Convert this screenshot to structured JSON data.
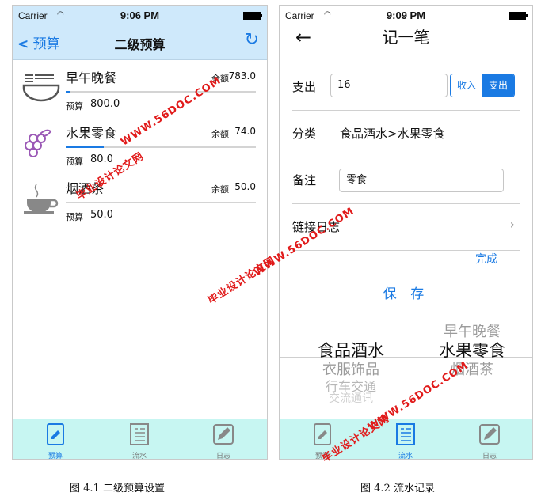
{
  "status": {
    "carrier": "Carrier",
    "time_left": "9:06 PM",
    "time_right": "9:09 PM"
  },
  "screen1": {
    "back_label": "预算",
    "title": "二级预算",
    "rows": [
      {
        "name": "早午晚餐",
        "remaining_label": "余额",
        "remaining": "783.0",
        "budget_label": "预算",
        "budget": "800.0",
        "progress": 0.02
      },
      {
        "name": "水果零食",
        "remaining_label": "余额",
        "remaining": "74.0",
        "budget_label": "预算",
        "budget": "80.0",
        "progress": 0.2
      },
      {
        "name": "烟酒茶",
        "remaining_label": "余额",
        "remaining": "50.0",
        "budget_label": "预算",
        "budget": "50.0",
        "progress": 0.0
      }
    ],
    "tabs": [
      {
        "label": "预算"
      },
      {
        "label": "流水"
      },
      {
        "label": "日志"
      }
    ]
  },
  "screen2": {
    "title": "记一笔",
    "expense_label": "支出",
    "amount_value": "16",
    "seg_income": "收入",
    "seg_expense": "支出",
    "category_label": "分类",
    "category_value": "食品酒水>水果零食",
    "note_label": "备注",
    "note_value": "零食",
    "link_diary": "链接日志",
    "done": "完成",
    "save": "保 存",
    "picker_left": [
      "食品酒水",
      "衣服饰品",
      "行车交通",
      "交流通讯"
    ],
    "picker_right": [
      "早午晚餐",
      "水果零食",
      "烟酒茶"
    ],
    "tabs": [
      {
        "label": "预算"
      },
      {
        "label": "流水"
      },
      {
        "label": "日志"
      }
    ]
  },
  "watermarks": {
    "url": "WWW.56DOC.COM",
    "site": "毕业设计论文网"
  },
  "captions": {
    "left": "图 4.1 二级预算设置",
    "right": "图 4.2 流水记录"
  },
  "colors": {
    "accent": "#1a7ae3",
    "nav_bg": "#cfe9fb",
    "tab_bg": "#c7f6f2",
    "watermark": "#e11b1b"
  }
}
